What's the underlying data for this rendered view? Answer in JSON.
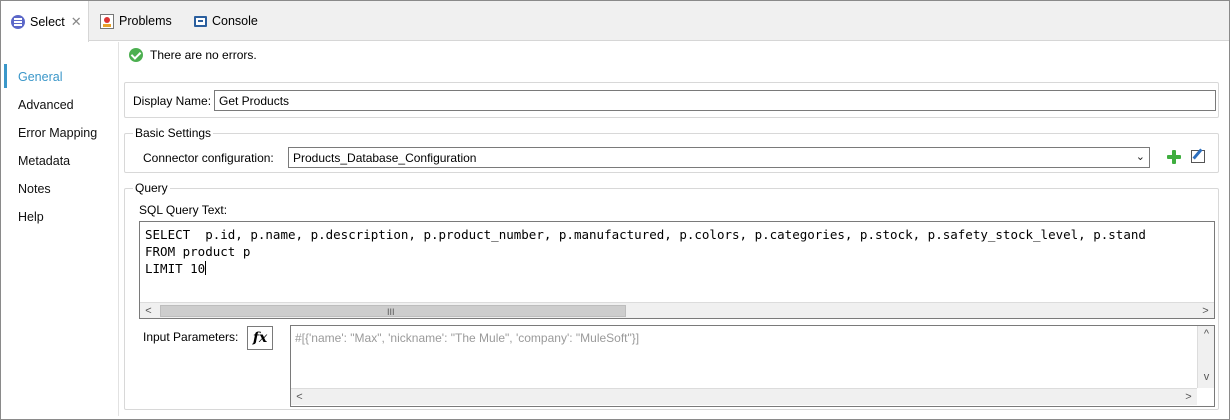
{
  "tabs": [
    {
      "label": "Select",
      "icon": "database-icon",
      "active": true
    },
    {
      "label": "Problems",
      "icon": "problems-icon"
    },
    {
      "label": "Console",
      "icon": "console-icon"
    }
  ],
  "nav": {
    "items": [
      {
        "label": "General",
        "active": true
      },
      {
        "label": "Advanced"
      },
      {
        "label": "Error Mapping"
      },
      {
        "label": "Metadata"
      },
      {
        "label": "Notes"
      },
      {
        "label": "Help"
      }
    ]
  },
  "status": {
    "message": "There are no errors.",
    "icon": "check-circle-icon"
  },
  "display_name": {
    "label": "Display Name:",
    "value": "Get Products"
  },
  "basic_settings": {
    "title": "Basic Settings",
    "connector_label": "Connector configuration:",
    "connector_value": "Products_Database_Configuration"
  },
  "query": {
    "title": "Query",
    "sql_label": "SQL Query Text:",
    "sql_lines": [
      "SELECT  p.id, p.name, p.description, p.product_number, p.manufactured, p.colors, p.categories, p.stock, p.safety_stock_level, p.stand",
      "FROM product p",
      "LIMIT 10"
    ],
    "params_label": "Input Parameters:",
    "fx_label": "fx",
    "params_placeholder": "#[{'name': \"Max\", 'nickname': \"The Mule\", 'company': \"MuleSoft\"}]"
  },
  "colors": {
    "accent": "#3b97c9",
    "success": "#4caf50",
    "add": "#3fae3f"
  }
}
